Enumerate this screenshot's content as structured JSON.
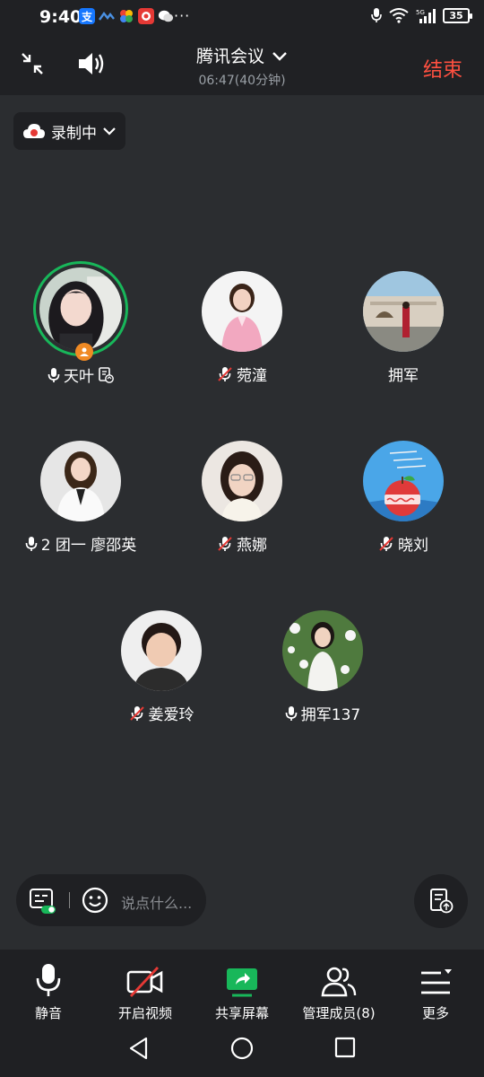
{
  "status_bar": {
    "time": "9:40",
    "battery": "35",
    "overflow": "···"
  },
  "header": {
    "title": "腾讯会议",
    "elapsed": "06:47(40分钟)",
    "end_label": "结束"
  },
  "recording": {
    "label": "录制中"
  },
  "participants": [
    {
      "name": "天叶",
      "mic": "on",
      "speaking": true,
      "host": true
    },
    {
      "name": "菀潼",
      "mic": "muted"
    },
    {
      "name": "拥军",
      "mic": "none"
    },
    {
      "name": "2 团一 廖邵英",
      "mic": "on"
    },
    {
      "name": "燕娜",
      "mic": "muted"
    },
    {
      "name": "晓刘",
      "mic": "muted"
    },
    {
      "name": "姜爱玲",
      "mic": "muted"
    },
    {
      "name": "拥军137",
      "mic": "on"
    }
  ],
  "chat": {
    "placeholder": "说点什么..."
  },
  "toolbar": {
    "mute_label": "静音",
    "video_label": "开启视频",
    "share_label": "共享屏幕",
    "members_label": "管理成员(8)",
    "more_label": "更多"
  },
  "colors": {
    "end_red": "#ff5040",
    "speaking_green": "#18b75a",
    "share_green": "#18b75a",
    "muted_red": "#e53935",
    "host_orange": "#f08a24"
  }
}
